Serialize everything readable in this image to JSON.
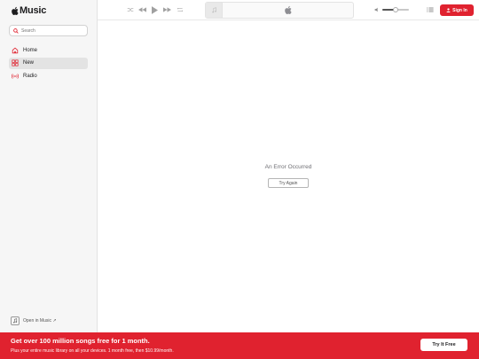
{
  "app": {
    "name": "Music"
  },
  "search": {
    "placeholder": "Search"
  },
  "sidebar": {
    "items": [
      {
        "label": "Home",
        "icon": "home-icon",
        "active": false
      },
      {
        "label": "New",
        "icon": "grid-icon",
        "active": true
      },
      {
        "label": "Radio",
        "icon": "radio-icon",
        "active": false
      }
    ],
    "open_in": "Open in Music ↗"
  },
  "toolbar": {
    "sign_in": "Sign In"
  },
  "main": {
    "error": "An Error Occurred",
    "retry": "Try Again"
  },
  "banner": {
    "headline": "Get over 100 million songs free for 1 month.",
    "subtext": "Plus your entire music library on all your devices. 1 month free, then $10.99/month.",
    "cta": "Try It Free"
  },
  "colors": {
    "accent": "#e0222f",
    "sidebar_bg": "#f6f6f6"
  }
}
